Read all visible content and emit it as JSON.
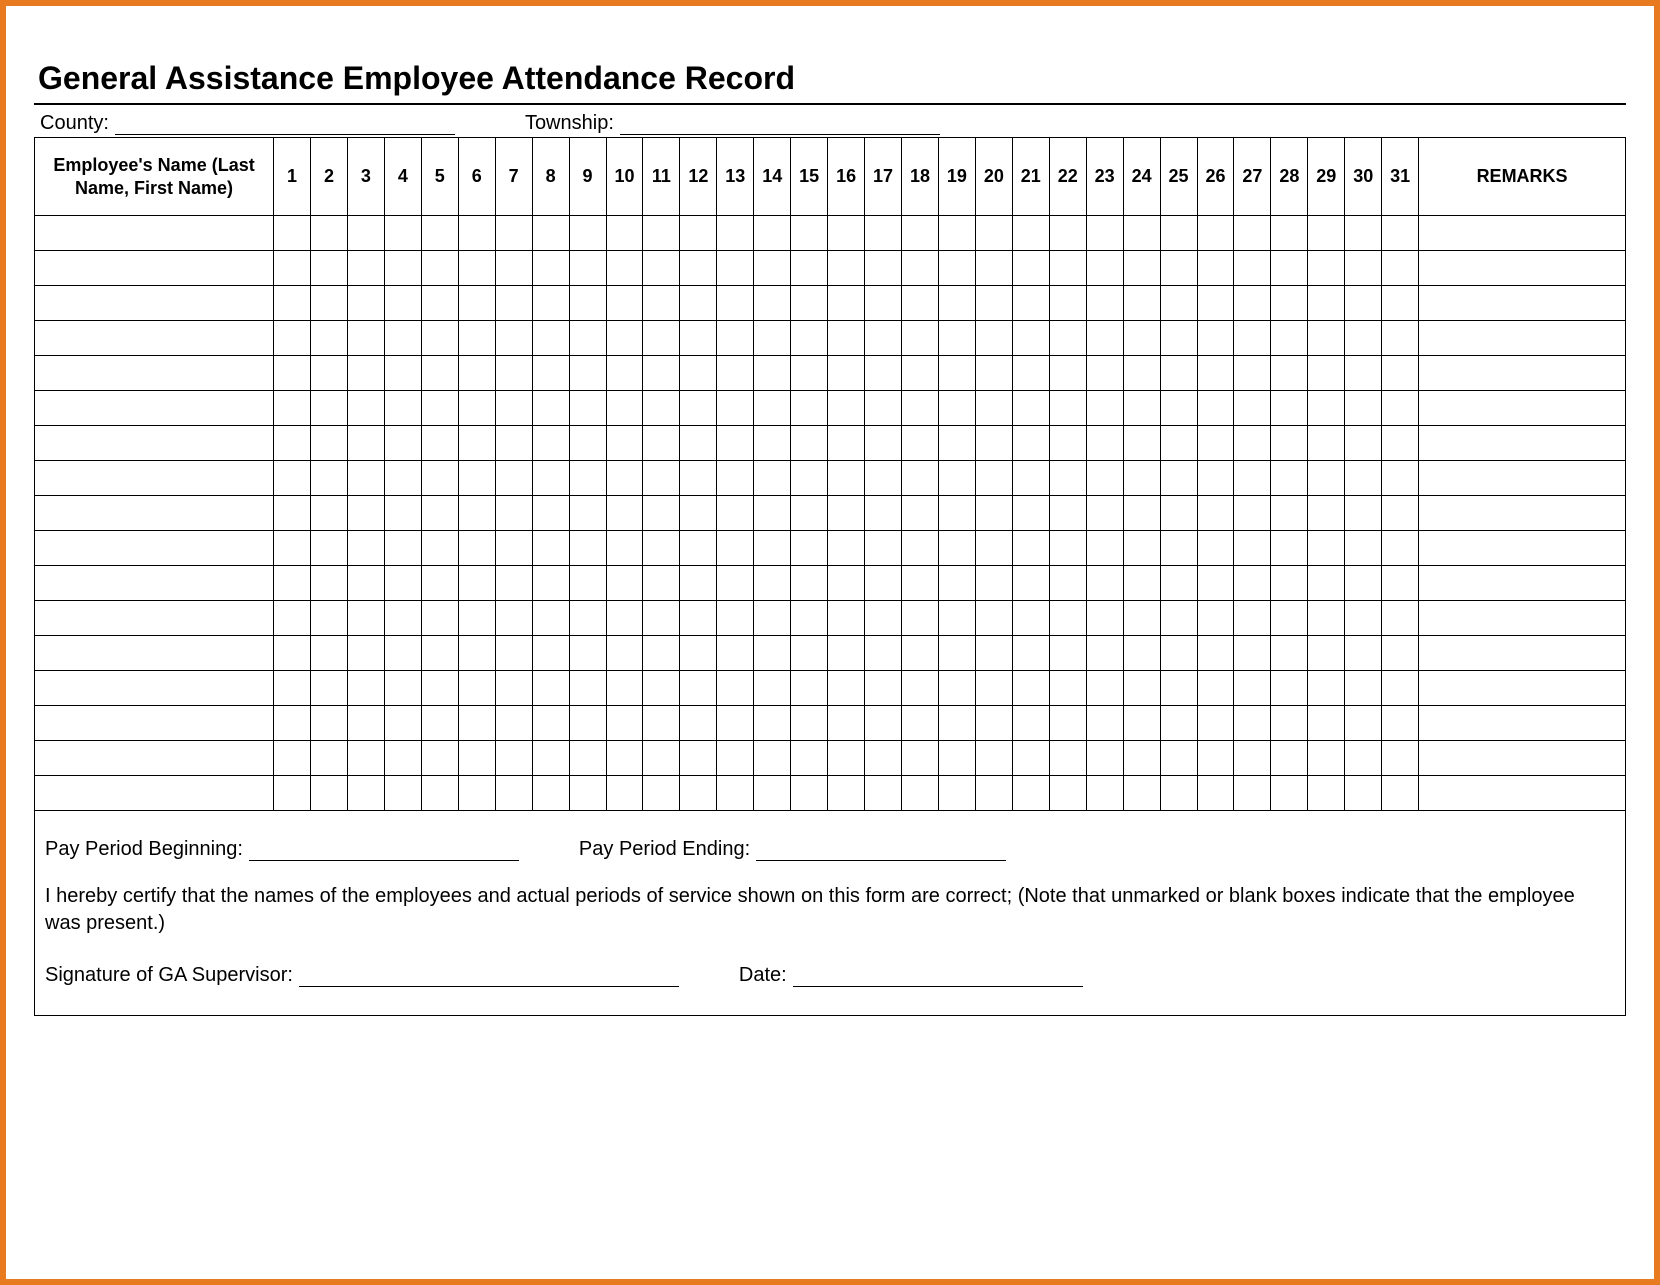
{
  "title": "General Assistance Employee Attendance Record",
  "meta": {
    "county_label": "County:",
    "county_value": "",
    "township_label": "Township:",
    "township_value": ""
  },
  "table": {
    "name_header": "Employee's Name (Last Name, First Name)",
    "day_headers": [
      "1",
      "2",
      "3",
      "4",
      "5",
      "6",
      "7",
      "8",
      "9",
      "10",
      "11",
      "12",
      "13",
      "14",
      "15",
      "16",
      "17",
      "18",
      "19",
      "20",
      "21",
      "22",
      "23",
      "24",
      "25",
      "26",
      "27",
      "28",
      "29",
      "30",
      "31"
    ],
    "remarks_header": "REMARKS",
    "row_count": 17
  },
  "footer": {
    "pay_begin_label": "Pay Period Beginning:",
    "pay_begin_value": "",
    "pay_end_label": "Pay Period Ending:",
    "pay_end_value": "",
    "certification_text": "I hereby certify that the names of the employees and actual periods of service shown on this form are correct;  (Note that unmarked or blank boxes indicate that the employee was present.)",
    "signature_label": "Signature of GA Supervisor:",
    "signature_value": "",
    "date_label": "Date:",
    "date_value": ""
  }
}
